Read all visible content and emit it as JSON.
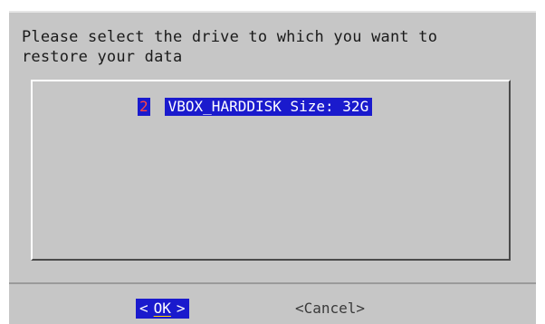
{
  "prompt": "Please select the drive to which you want to\nrestore your data",
  "list": {
    "items": [
      {
        "number": "2",
        "label": "VBOX_HARDDISK Size: 32G",
        "selected": true
      }
    ]
  },
  "buttons": {
    "ok": {
      "left_bracket": "<",
      "label": "OK",
      "right_bracket": ">"
    },
    "cancel": {
      "label": "<Cancel>"
    }
  },
  "colors": {
    "dialog_bg": "#c6c6c6",
    "highlight_bg": "#1a1acd",
    "highlight_text": "#ffffff",
    "number_text": "#ff4444",
    "hotkey_underline": "#ffd400"
  }
}
